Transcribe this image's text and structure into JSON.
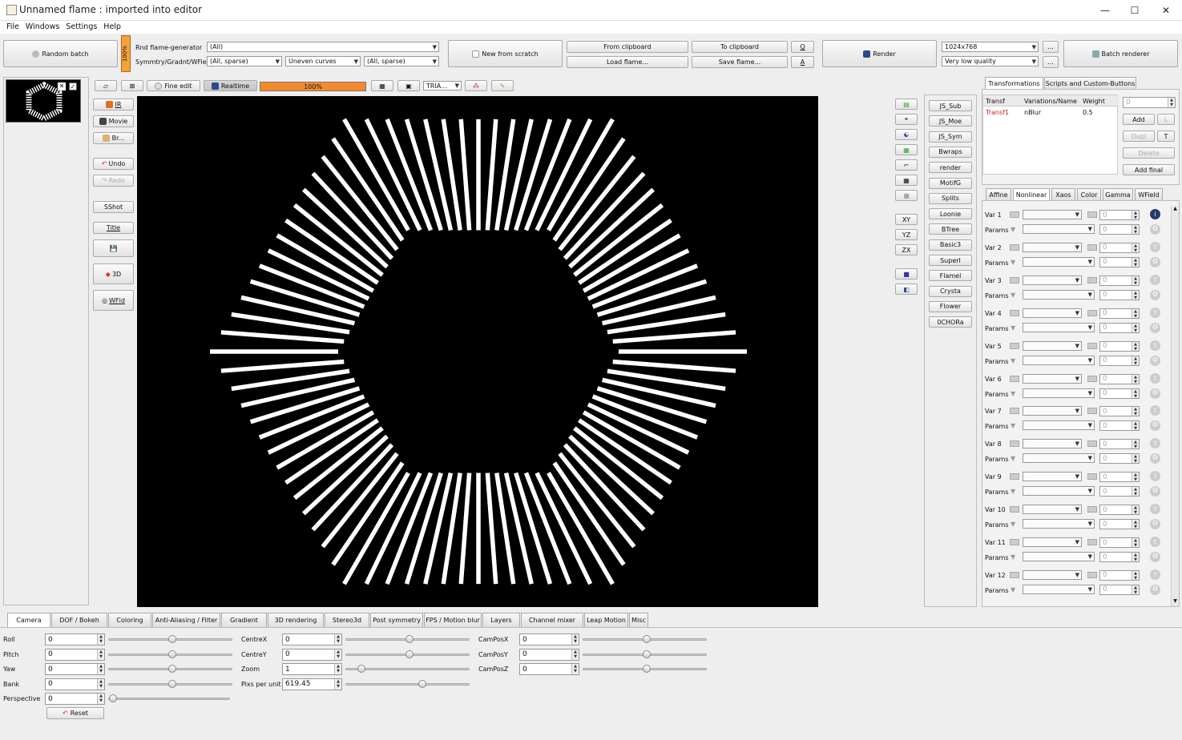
{
  "window": {
    "title": "Unnamed flame : imported into editor"
  },
  "menu": [
    "File",
    "Windows",
    "Settings",
    "Help"
  ],
  "toolbar": {
    "random_batch": "Random batch",
    "pct_vertical": "100%",
    "rnd_label": "Rnd flame-generator",
    "sym_label": "Symmtry/Gradnt/WField",
    "rnd_value": "(All)",
    "sym_value1": "(All, sparse)",
    "sym_value2": "Uneven curves",
    "sym_value3": "(All, sparse)",
    "new_scratch": "New from scratch",
    "from_clipboard": "From clipboard",
    "to_clipboard": "To clipboard",
    "q": "Q",
    "load_flame": "Load flame...",
    "save_flame": "Save flame...",
    "a": "A",
    "render": "Render",
    "resolution": "1024x768",
    "quality": "Very low quality",
    "dots": "...",
    "batch_renderer": "Batch renderer"
  },
  "preview_toolbar": {
    "fine_edit": "Fine edit",
    "realtime": "Realtime",
    "progress": "100%",
    "progress_fraction": 1.0,
    "tria": "TRIA..."
  },
  "left_tools": {
    "ir": "IR",
    "movie": "Movie",
    "br": "Br...",
    "undo": "Undo",
    "redo": "Redo",
    "sshot": "SShot",
    "title": "Title",
    "three_d": "3D",
    "wfld": "WFld"
  },
  "axis_buttons": [
    "XY",
    "YZ",
    "ZX"
  ],
  "scripts": [
    "JS_Sub",
    "JS_Moe",
    "JS_Sym",
    "Bwraps",
    "render",
    "MotifG",
    "Splits",
    "Loonie",
    "BTree",
    "Basic3",
    "SuperI",
    "Flamel",
    "Crysta",
    "Flower",
    "0CHORa"
  ],
  "right_tabs": [
    "Transformations",
    "Scripts and Custom-Buttons"
  ],
  "transform_table": {
    "headers": [
      "Transf",
      "Variations/Name",
      "Weight"
    ],
    "rows": [
      {
        "transf": "Transf1",
        "name": "nBlur",
        "weight": "0.5"
      }
    ],
    "weight_field": "0",
    "add": "Add",
    "l": "L",
    "dupl": "Dupl",
    "t": "T",
    "delete": "Delete",
    "add_final": "Add final"
  },
  "sub_tabs": [
    "Affine",
    "Nonlinear",
    "Xaos",
    "Color",
    "Gamma",
    "WField"
  ],
  "variations": [
    {
      "var": "Var 1",
      "value": "0",
      "params": "Params",
      "params_value": "0"
    },
    {
      "var": "Var 2",
      "value": "0",
      "params": "Params",
      "params_value": "0"
    },
    {
      "var": "Var 3",
      "value": "0",
      "params": "Params",
      "params_value": "0"
    },
    {
      "var": "Var 4",
      "value": "0",
      "params": "Params",
      "params_value": "0"
    },
    {
      "var": "Var 5",
      "value": "0",
      "params": "Params",
      "params_value": "0"
    },
    {
      "var": "Var 6",
      "value": "0",
      "params": "Params",
      "params_value": "0"
    },
    {
      "var": "Var 7",
      "value": "0",
      "params": "Params",
      "params_value": "0"
    },
    {
      "var": "Var 8",
      "value": "0",
      "params": "Params",
      "params_value": "0"
    },
    {
      "var": "Var 9",
      "value": "0",
      "params": "Params",
      "params_value": "0"
    },
    {
      "var": "Var 10",
      "value": "0",
      "params": "Params",
      "params_value": "0"
    },
    {
      "var": "Var 11",
      "value": "0",
      "params": "Params",
      "params_value": "0"
    },
    {
      "var": "Var 12",
      "value": "0",
      "params": "Params",
      "params_value": "0"
    }
  ],
  "bottom_tabs": [
    "Camera",
    "DOF / Bokeh",
    "Coloring",
    "Anti-Aliasing / Filter",
    "Gradient",
    "3D rendering",
    "Stereo3d",
    "Post symmetry",
    "FPS / Motion blur",
    "Layers",
    "Channel mixer",
    "Leap Motion",
    "Misc"
  ],
  "camera": {
    "col1": [
      {
        "label": "Roll",
        "value": "0"
      },
      {
        "label": "Pitch",
        "value": "0"
      },
      {
        "label": "Yaw",
        "value": "0"
      },
      {
        "label": "Bank",
        "value": "0"
      },
      {
        "label": "Perspective",
        "value": "0"
      }
    ],
    "col2": [
      {
        "label": "CentreX",
        "value": "0"
      },
      {
        "label": "CentreY",
        "value": "0"
      },
      {
        "label": "Zoom",
        "value": "1"
      },
      {
        "label": "Pixs per unit",
        "value": "619.45"
      }
    ],
    "col3": [
      {
        "label": "CamPosX",
        "value": "0"
      },
      {
        "label": "CamPosY",
        "value": "0"
      },
      {
        "label": "CamPosZ",
        "value": "0"
      }
    ],
    "reset": "Reset"
  },
  "colors": {
    "accent_orange": "#f4a23c",
    "transf_red": "#cc2222",
    "canvas": "#000000"
  }
}
